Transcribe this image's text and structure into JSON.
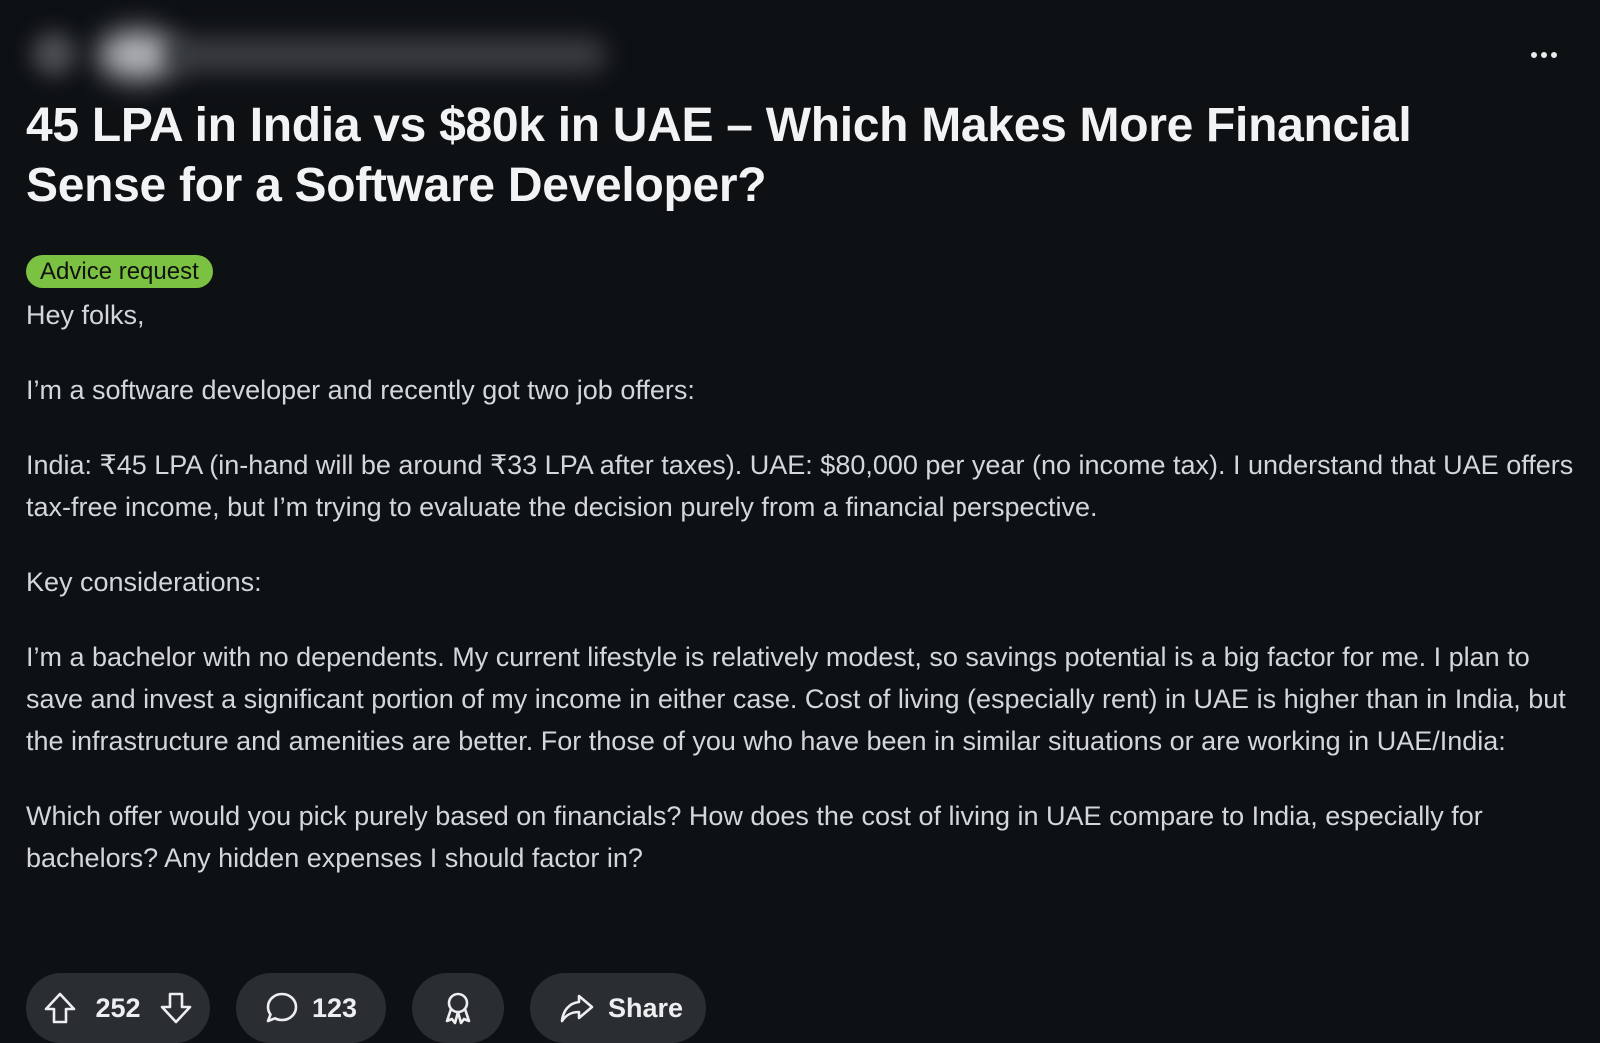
{
  "post": {
    "title": "45 LPA in India vs $80k in UAE – Which Makes More Financial Sense for a Software Developer?",
    "flair": "Advice request",
    "body": [
      "Hey folks,",
      "I’m a software developer and recently got two job offers:",
      "India: ₹45 LPA (in-hand will be around ₹33 LPA after taxes). UAE: $80,000 per year (no income tax). I understand that UAE offers tax-free income, but I’m trying to evaluate the decision purely from a financial perspective.",
      "Key considerations:",
      "I’m a bachelor with no dependents. My current lifestyle is relatively modest, so savings potential is a big factor for me. I plan to save and invest a significant portion of my income in either case. Cost of living (especially rent) in UAE is higher than in India, but the infrastructure and amenities are better. For those of you who have been in similar situations or are working in UAE/India:",
      "Which offer would you pick purely based on financials? How does the cost of living in UAE compare to India, especially for bachelors? Any hidden expenses I should factor in?"
    ]
  },
  "actions": {
    "votes": "252",
    "comments": "123",
    "share_label": "Share"
  },
  "colors": {
    "background": "#0e1114",
    "flair": "#7cc242",
    "pill": "#2a2d31"
  },
  "icons": {
    "more": "more-horizontal-icon",
    "upvote": "upvote-arrow-icon",
    "downvote": "downvote-arrow-icon",
    "comment": "comment-bubble-icon",
    "award": "award-icon",
    "share": "share-arrow-icon"
  }
}
